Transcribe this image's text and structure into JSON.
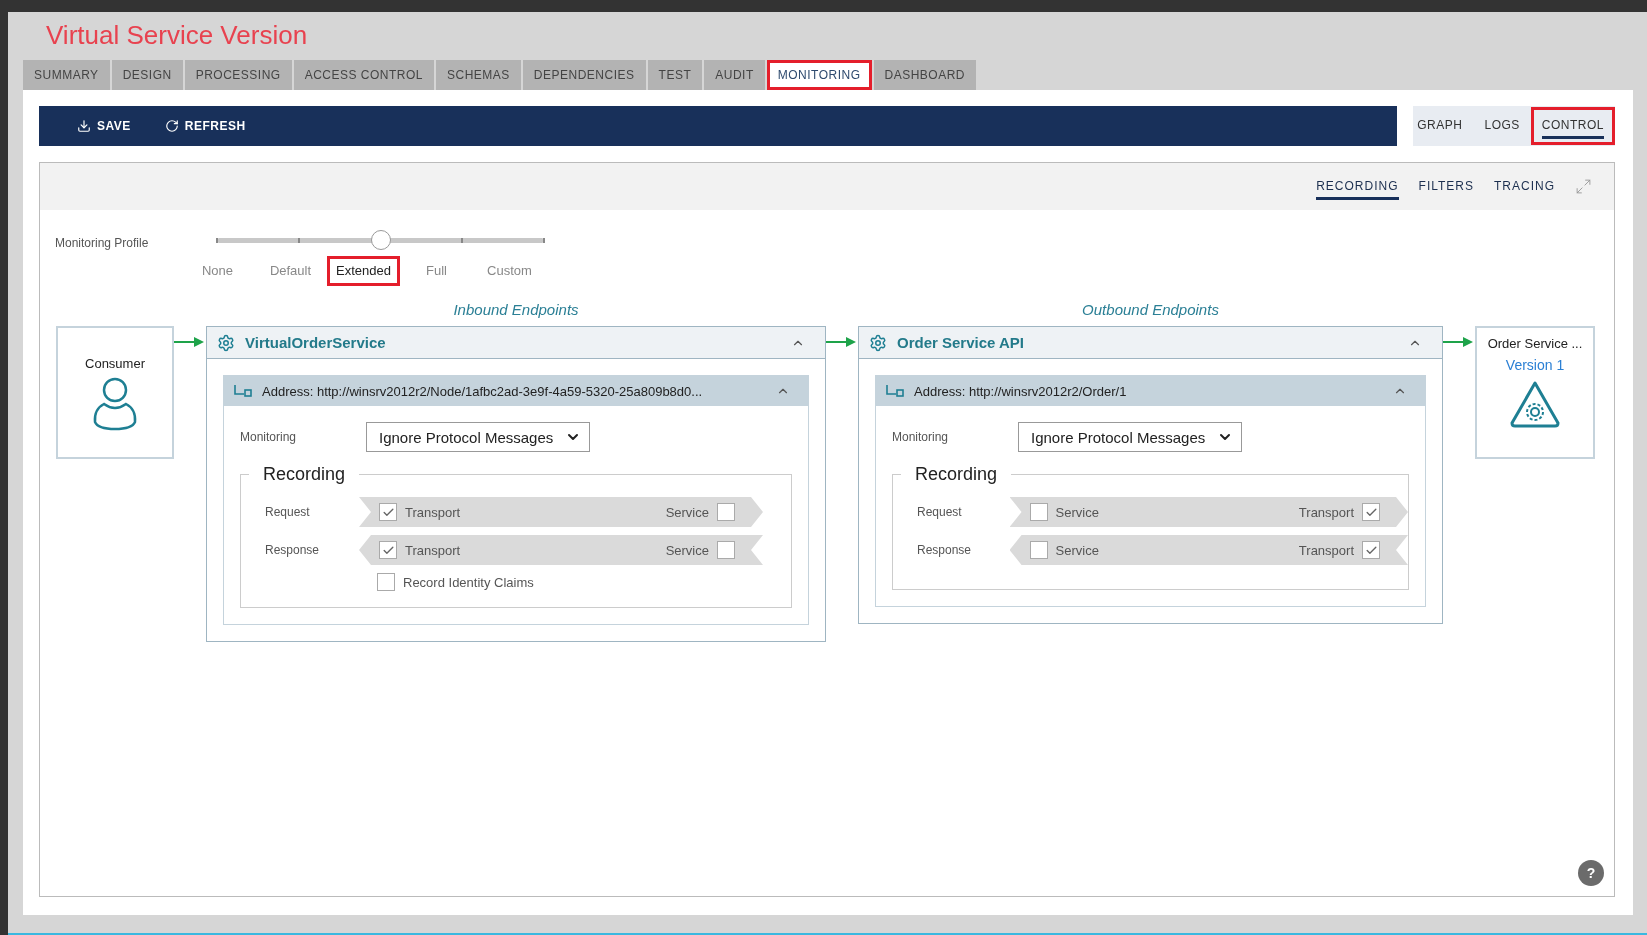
{
  "page_title": "Virtual Service Version",
  "tabs": [
    {
      "label": "SUMMARY",
      "selected": false,
      "highlighted": false
    },
    {
      "label": "DESIGN",
      "selected": false,
      "highlighted": false
    },
    {
      "label": "PROCESSING",
      "selected": false,
      "highlighted": false
    },
    {
      "label": "ACCESS CONTROL",
      "selected": false,
      "highlighted": false
    },
    {
      "label": "SCHEMAS",
      "selected": false,
      "highlighted": false
    },
    {
      "label": "DEPENDENCIES",
      "selected": false,
      "highlighted": false
    },
    {
      "label": "TEST",
      "selected": false,
      "highlighted": false
    },
    {
      "label": "AUDIT",
      "selected": false,
      "highlighted": false
    },
    {
      "label": "MONITORING",
      "selected": true,
      "highlighted": true
    },
    {
      "label": "DASHBOARD",
      "selected": false,
      "highlighted": false
    }
  ],
  "toolbar": [
    {
      "label": "SAVE",
      "kind": "save"
    },
    {
      "label": "REFRESH",
      "kind": "refresh"
    }
  ],
  "view_tabs": [
    {
      "label": "GRAPH",
      "selected": false,
      "highlighted": false
    },
    {
      "label": "LOGS",
      "selected": false,
      "highlighted": false
    },
    {
      "label": "CONTROL",
      "selected": true,
      "highlighted": true
    }
  ],
  "sub_tabs": [
    {
      "label": "RECORDING",
      "selected": true
    },
    {
      "label": "FILTERS",
      "selected": false
    },
    {
      "label": "TRACING",
      "selected": false
    }
  ],
  "monitoring_profile": {
    "label": "Monitoring Profile",
    "level": 0.5,
    "stops": [
      {
        "label": "None",
        "selected": false,
        "highlighted": false
      },
      {
        "label": "Default",
        "selected": false,
        "highlighted": false
      },
      {
        "label": "Extended",
        "selected": true,
        "highlighted": true
      },
      {
        "label": "Full",
        "selected": false,
        "highlighted": false
      },
      {
        "label": "Custom",
        "selected": false,
        "highlighted": false
      }
    ]
  },
  "consumer": {
    "label": "Consumer"
  },
  "inbound": {
    "heading": "Inbound Endpoints",
    "service": "VirtualOrderService",
    "expanded": true,
    "address": "Address: http://winsrv2012r2/Node/1afbc2ad-3e9f-4a59-5320-25a809b8d0...",
    "address_expanded": true,
    "monitoring_label": "Monitoring",
    "monitoring_value": "Ignore Protocol Messages",
    "recording_title": "Recording",
    "rows": [
      {
        "label": "Request",
        "kind": "forward",
        "items": [
          {
            "label": "Transport",
            "checked": true
          },
          {
            "label": "Service",
            "checked": false
          }
        ]
      },
      {
        "label": "Response",
        "kind": "backward",
        "items": [
          {
            "label": "Transport",
            "checked": true
          },
          {
            "label": "Service",
            "checked": false
          }
        ]
      }
    ],
    "extra_options": [
      {
        "label": "Record Identity Claims",
        "checked": false
      }
    ]
  },
  "outbound": {
    "heading": "Outbound Endpoints",
    "service": "Order Service API",
    "expanded": true,
    "address": "Address: http://winsrv2012r2/Order/1",
    "address_expanded": true,
    "monitoring_label": "Monitoring",
    "monitoring_value": "Ignore Protocol Messages",
    "recording_title": "Recording",
    "rows": [
      {
        "label": "Request",
        "kind": "forward",
        "items": [
          {
            "label": "Service",
            "checked": false
          },
          {
            "label": "Transport",
            "checked": true
          }
        ]
      },
      {
        "label": "Response",
        "kind": "backward",
        "items": [
          {
            "label": "Service",
            "checked": false
          },
          {
            "label": "Transport",
            "checked": true
          }
        ]
      }
    ]
  },
  "target": {
    "name": "Order Service ...",
    "version": "Version 1"
  },
  "help": {
    "label": "?"
  }
}
